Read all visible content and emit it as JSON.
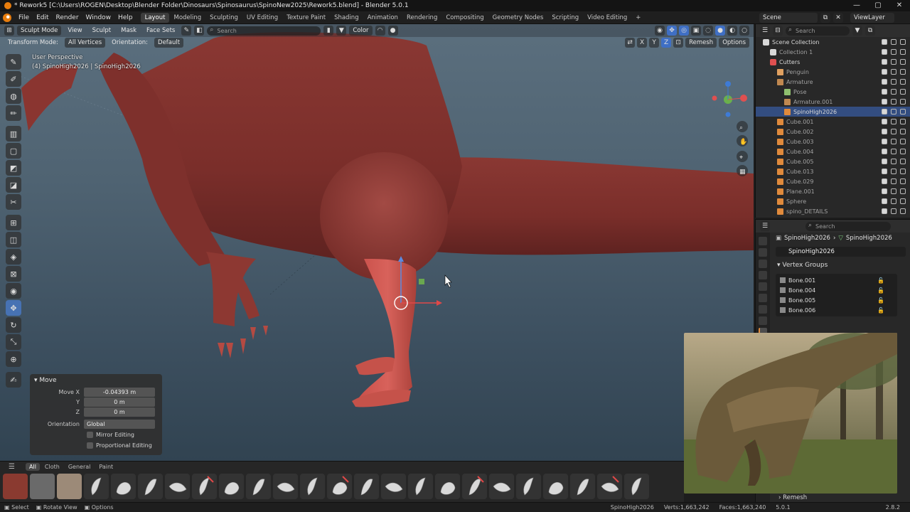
{
  "window": {
    "title": "* Rework5 [C:\\Users\\ROGEN\\Desktop\\Blender Folder\\Dinosaurs\\Spinosaurus\\SpinoNew2025\\Rework5.blend] - Blender 5.0.1",
    "controls": [
      "—",
      "▢",
      "✕"
    ]
  },
  "menu": [
    "File",
    "Edit",
    "Render",
    "Window",
    "Help"
  ],
  "workspaces": [
    "Layout",
    "Modeling",
    "Sculpting",
    "UV Editing",
    "Texture Paint",
    "Shading",
    "Animation",
    "Rendering",
    "Compositing",
    "Geometry Nodes",
    "Scripting",
    "Video Editing",
    "+"
  ],
  "active_workspace": "Layout",
  "scene": {
    "scene_name": "Scene",
    "view_layer": "ViewLayer"
  },
  "viewport": {
    "mode": "Sculpt Mode",
    "menus": [
      "View",
      "Sculpt",
      "Mask",
      "Face Sets"
    ],
    "search_placeholder": "Search",
    "color_label": "Color",
    "transform_mode_label": "Transform Mode:",
    "transform_mode_value": "All Vertices",
    "orientation_label": "Orientation:",
    "orientation_value": "Default",
    "axes": [
      "X",
      "Y",
      "Z"
    ],
    "remesh": "Remesh",
    "options": "Options",
    "perspective": "User Perspective",
    "object_info": "(4) SpinoHigh2026 | SpinoHigh2026"
  },
  "operator_panel": {
    "title": "Move",
    "move_x_label": "Move X",
    "move_x": "-0.04393 m",
    "y_label": "Y",
    "y": "0 m",
    "z_label": "Z",
    "z": "0 m",
    "orientation_label": "Orientation",
    "orientation": "Global",
    "mirror_editing": "Mirror Editing",
    "proportional_editing": "Proportional Editing"
  },
  "asset_shelf": {
    "tabs": [
      "All",
      "Cloth",
      "General",
      "Paint"
    ],
    "active_tab": "All"
  },
  "outliner": {
    "search_placeholder": "Search",
    "items": [
      {
        "label": "Scene Collection",
        "indent": 0,
        "dim": false,
        "selected": false,
        "icon": "collection-icon"
      },
      {
        "label": "Collection 1",
        "indent": 1,
        "dim": true,
        "selected": false,
        "icon": "collection-icon"
      },
      {
        "label": "Cutters",
        "indent": 1,
        "dim": false,
        "selected": false,
        "icon": "collection-red-icon"
      },
      {
        "label": "Penguin",
        "indent": 2,
        "dim": true,
        "selected": false,
        "icon": "object-icon"
      },
      {
        "label": "Armature",
        "indent": 2,
        "dim": true,
        "selected": false,
        "icon": "armature-icon"
      },
      {
        "label": "Pose",
        "indent": 3,
        "dim": true,
        "selected": false,
        "icon": "pose-icon"
      },
      {
        "label": "Armature.001",
        "indent": 3,
        "dim": true,
        "selected": false,
        "icon": "armature-icon"
      },
      {
        "label": "SpinoHigh2026",
        "indent": 3,
        "dim": false,
        "selected": true,
        "icon": "mesh-icon"
      },
      {
        "label": "Cube.001",
        "indent": 2,
        "dim": true,
        "selected": false,
        "icon": "mesh-icon"
      },
      {
        "label": "Cube.002",
        "indent": 2,
        "dim": true,
        "selected": false,
        "icon": "mesh-icon"
      },
      {
        "label": "Cube.003",
        "indent": 2,
        "dim": true,
        "selected": false,
        "icon": "mesh-icon"
      },
      {
        "label": "Cube.004",
        "indent": 2,
        "dim": true,
        "selected": false,
        "icon": "mesh-icon"
      },
      {
        "label": "Cube.005",
        "indent": 2,
        "dim": true,
        "selected": false,
        "icon": "mesh-icon"
      },
      {
        "label": "Cube.013",
        "indent": 2,
        "dim": true,
        "selected": false,
        "icon": "mesh-icon"
      },
      {
        "label": "Cube.029",
        "indent": 2,
        "dim": true,
        "selected": false,
        "icon": "mesh-icon"
      },
      {
        "label": "Plane.001",
        "indent": 2,
        "dim": true,
        "selected": false,
        "icon": "mesh-icon"
      },
      {
        "label": "Sphere",
        "indent": 2,
        "dim": true,
        "selected": false,
        "icon": "mesh-icon"
      },
      {
        "label": "spino_DETAILS",
        "indent": 2,
        "dim": true,
        "selected": false,
        "icon": "mesh-icon"
      }
    ]
  },
  "properties": {
    "search_placeholder": "Search",
    "breadcrumb_object": "SpinoHigh2026",
    "breadcrumb_separator": "›",
    "breadcrumb_data": "SpinoHigh2026",
    "data_name": "SpinoHigh2026",
    "vertex_groups_title": "Vertex Groups",
    "vertex_groups": [
      "Bone.001",
      "Bone.004",
      "Bone.005",
      "Bone.006"
    ],
    "remesh_section": "Remesh"
  },
  "status_bar": {
    "select": "Select",
    "rotate_view": "Rotate View",
    "options": "Options",
    "object": "SpinoHigh2026",
    "verts": "Verts:1,663,242",
    "faces": "Faces:1,663,240",
    "version_left": "5.0.1",
    "version_right": "2.8.2"
  },
  "colors": {
    "accent_blue": "#4772b3",
    "selection": "#334d80",
    "model_red": "#8f3a35",
    "blender_orange": "#e87d0d"
  }
}
